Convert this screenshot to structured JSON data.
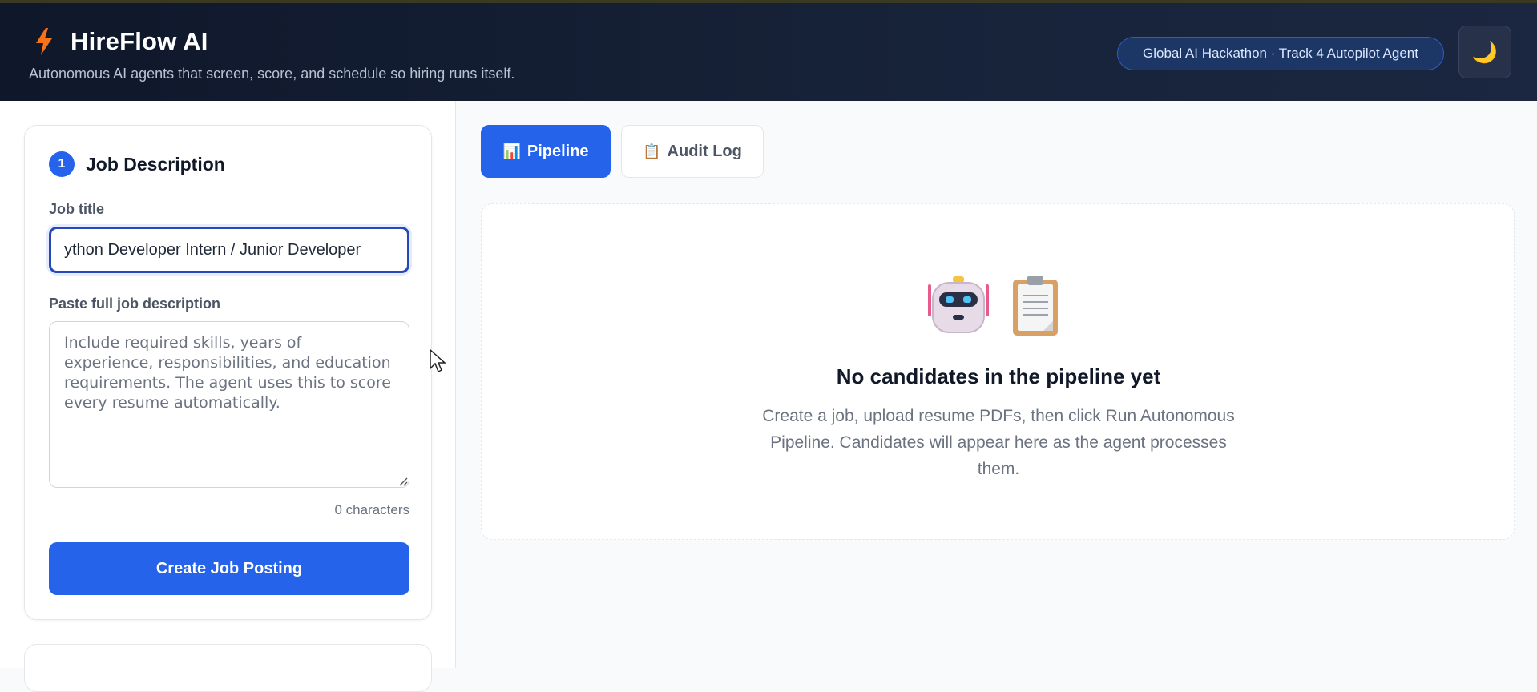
{
  "header": {
    "title": "HireFlow AI",
    "tagline": "Autonomous AI agents that screen, score, and schedule so hiring runs itself.",
    "badge": "Global AI Hackathon · Track 4 Autopilot Agent",
    "theme_icon": "moon-icon",
    "theme_glyph": "🌙",
    "logo_icon": "bolt-icon",
    "accent_color": "#f97316"
  },
  "job_card": {
    "step_number": "1",
    "title": "Job Description",
    "job_title_label": "Job title",
    "job_title_value": "ython Developer Intern / Junior Developer",
    "description_label": "Paste full job description",
    "description_placeholder": "Include required skills, years of experience, responsibilities, and education requirements. The agent uses this to score every resume automatically.",
    "description_value": "",
    "char_count": "0 characters",
    "create_button": "Create Job Posting",
    "primary_color": "#2563eb"
  },
  "tabs": [
    {
      "label": "Pipeline",
      "icon": "bar-chart-icon",
      "glyph": "📊",
      "active": true
    },
    {
      "label": "Audit Log",
      "icon": "clipboard-icon",
      "glyph": "📋",
      "active": false
    }
  ],
  "empty_state": {
    "icons": [
      "robot-icon",
      "clipboard-icon"
    ],
    "title": "No candidates in the pipeline yet",
    "message": "Create a job, upload resume PDFs, then click Run Autonomous Pipeline. Candidates will appear here as the agent processes them."
  }
}
